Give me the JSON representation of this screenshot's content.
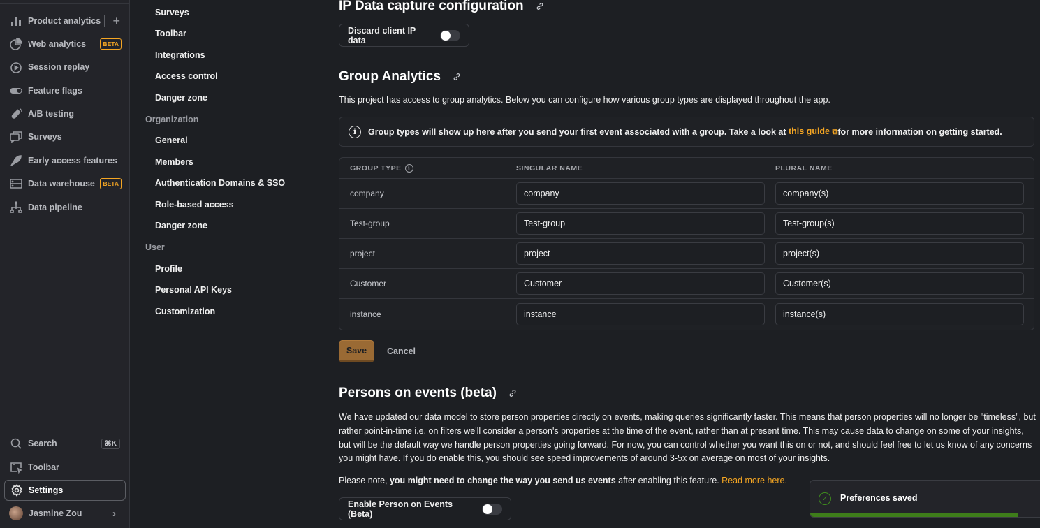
{
  "nav": {
    "items": [
      {
        "label": "Product analytics",
        "icon": "bar-chart-icon"
      },
      {
        "label": "Web analytics",
        "icon": "pie-chart-icon",
        "badge": "BETA"
      },
      {
        "label": "Session replay",
        "icon": "replay-icon"
      },
      {
        "label": "Feature flags",
        "icon": "toggle-icon"
      },
      {
        "label": "A/B testing",
        "icon": "flask-icon"
      },
      {
        "label": "Surveys",
        "icon": "chat-icon"
      },
      {
        "label": "Early access features",
        "icon": "rocket-icon"
      },
      {
        "label": "Data warehouse",
        "icon": "server-icon",
        "badge": "BETA"
      },
      {
        "label": "Data pipeline",
        "icon": "pipeline-icon"
      }
    ],
    "bottom": {
      "search": "Search",
      "search_shortcut": "⌘K",
      "toolbar": "Toolbar",
      "settings": "Settings",
      "user": "Jasmine Zou"
    }
  },
  "settings_nav": {
    "project_items": [
      "Surveys",
      "Toolbar",
      "Integrations",
      "Access control",
      "Danger zone"
    ],
    "organization_heading": "Organization",
    "organization_items": [
      "General",
      "Members",
      "Authentication Domains & SSO",
      "Role-based access",
      "Danger zone"
    ],
    "user_heading": "User",
    "user_items": [
      "Profile",
      "Personal API Keys",
      "Customization"
    ]
  },
  "ip_section": {
    "title": "IP Data capture configuration",
    "toggle_label": "Discard client IP data",
    "toggle_on": false
  },
  "group_section": {
    "title": "Group Analytics",
    "description": "This project has access to group analytics. Below you can configure how various group types are displayed throughout the app.",
    "info_pre": "Group types will show up here after you send your first event associated with a group. Take a look at ",
    "info_link": "this guide",
    "info_post": "for more information on getting started.",
    "columns": [
      "GROUP TYPE",
      "SINGULAR NAME",
      "PLURAL NAME"
    ],
    "rows": [
      {
        "type": "company",
        "singular": "company",
        "plural": "company(s)"
      },
      {
        "type": "Test-group",
        "singular": "Test-group",
        "plural": "Test-group(s)"
      },
      {
        "type": "project",
        "singular": "project",
        "plural": "project(s)"
      },
      {
        "type": "Customer",
        "singular": "Customer",
        "plural": "Customer(s)"
      },
      {
        "type": "instance",
        "singular": "instance",
        "plural": "instance(s)"
      }
    ],
    "save_label": "Save",
    "cancel_label": "Cancel"
  },
  "poe_section": {
    "title": "Persons on events (beta)",
    "paragraph": "We have updated our data model to store person properties directly on events, making queries significantly faster. This means that person properties will no longer be \"timeless\", but rather point-in-time i.e. on filters we'll consider a person's properties at the time of the event, rather than at present time. This may cause data to change on some of your insights, but will be the default way we handle person properties going forward. For now, you can control whether you want this on or not, and should feel free to let us know of any concerns you might have. If you do enable this, you should see speed improvements of around 3-5x on average on most of your insights.",
    "note_pre": "Please note, ",
    "note_bold": "you might need to change the way you send us events",
    "note_post": " after enabling this feature. ",
    "note_link": "Read more here.",
    "toggle_label": "Enable Person on Events (Beta)",
    "toggle_on": false
  },
  "toast": {
    "message": "Preferences saved",
    "progress": 0.88
  }
}
